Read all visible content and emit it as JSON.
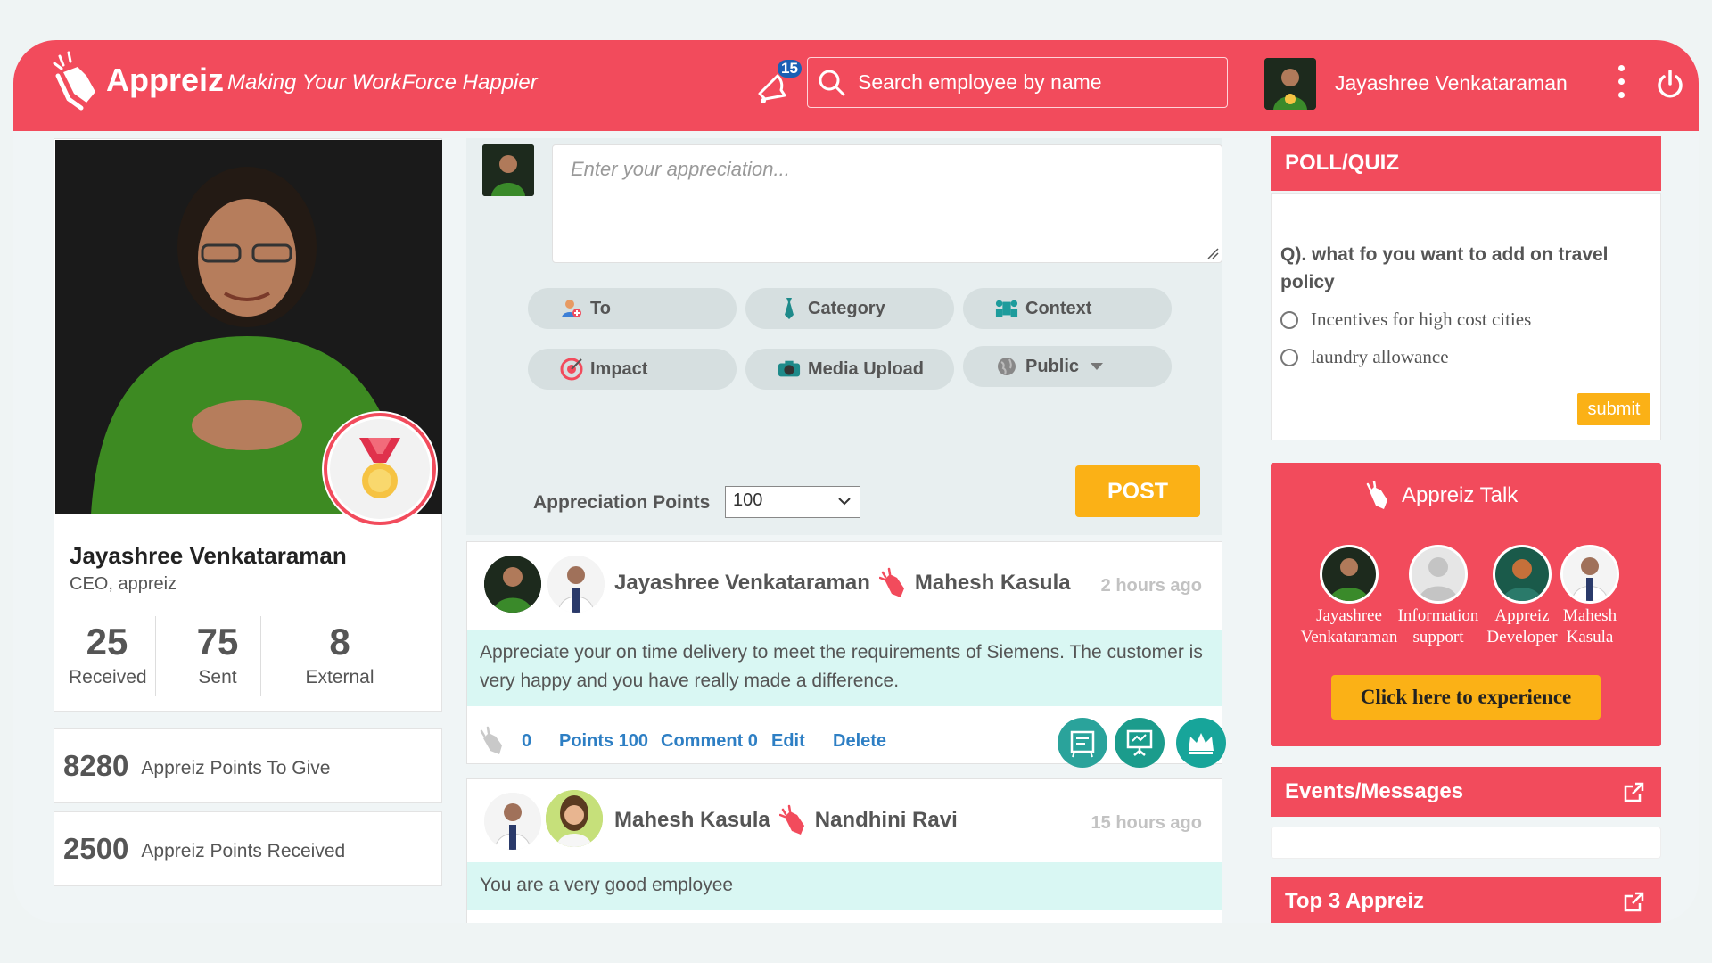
{
  "header": {
    "app_name": "Appreiz",
    "tagline": "Making Your WorkForce Happier",
    "notification_count": "15",
    "search_placeholder": "Search employee by name",
    "user_name": "Jayashree Venkataraman"
  },
  "profile": {
    "name": "Jayashree Venkataraman",
    "role": "CEO, appreiz",
    "stats": [
      {
        "value": "25",
        "label": "Received"
      },
      {
        "value": "75",
        "label": "Sent"
      },
      {
        "value": "8",
        "label": "External"
      }
    ],
    "points_to_give": {
      "value": "8280",
      "label": "Appreiz Points To Give"
    },
    "points_received": {
      "value": "2500",
      "label": "Appreiz Points Received"
    }
  },
  "composer": {
    "placeholder": "Enter your appreciation...",
    "buttons": {
      "to": "To",
      "category": "Category",
      "context": "Context",
      "impact": "Impact",
      "media_upload": "Media Upload",
      "public": "Public"
    },
    "points_label": "Appreciation Points",
    "points_value": "100",
    "post_label": "POST"
  },
  "feed": [
    {
      "from": "Jayashree Venkataraman",
      "to": "Mahesh Kasula",
      "time": "2 hours ago",
      "message": "Appreciate your on time delivery to meet the requirements of Siemens. The customer is very happy and you have really made a difference.",
      "claps": "0",
      "points": "Points 100",
      "comments": "Comment 0",
      "edit": "Edit",
      "delete": "Delete"
    },
    {
      "from": "Mahesh Kasula",
      "to": "Nandhini Ravi",
      "time": "15 hours ago",
      "message": "You are a very good employee"
    }
  ],
  "poll": {
    "title": "POLL/QUIZ",
    "question": "Q). what fo you want to add on travel policy",
    "options": [
      "Incentives for high cost cities",
      "laundry allowance"
    ],
    "submit": "submit"
  },
  "talk": {
    "title": "Appreiz Talk",
    "people": [
      {
        "line1": "Jayashree",
        "line2": "Venkataraman"
      },
      {
        "line1": "Information",
        "line2": "support"
      },
      {
        "line1": "Appreiz",
        "line2": "Developer"
      },
      {
        "line1": "Mahesh",
        "line2": "Kasula"
      }
    ],
    "cta": "Click here to experience"
  },
  "events_title": "Events/Messages",
  "top3_title": "Top 3 Appreiz",
  "colors": {
    "brand": "#f24b5c",
    "accent": "#fbb116",
    "link": "#2e7fc4",
    "message_bg": "#d9f7f3"
  }
}
